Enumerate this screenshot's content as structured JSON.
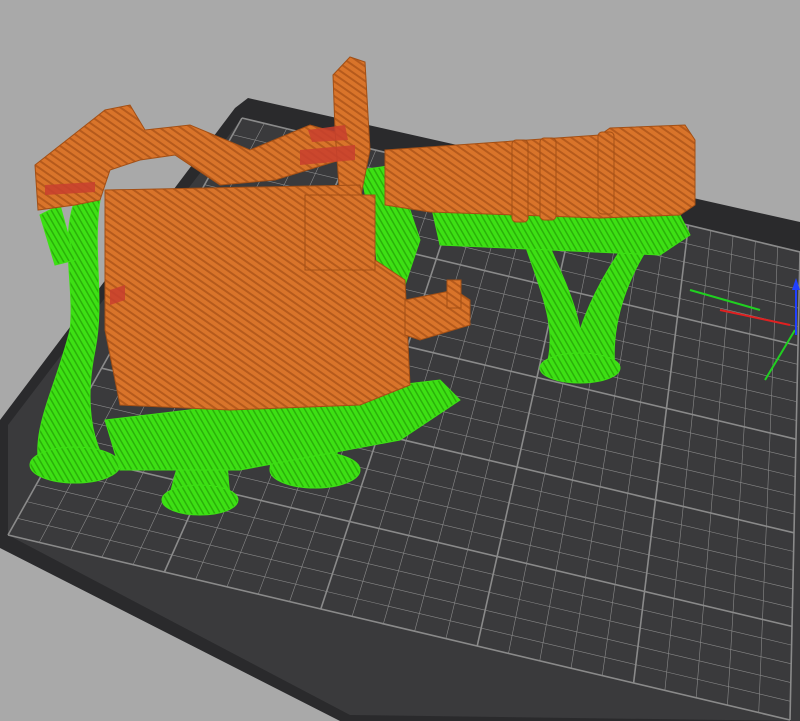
{
  "viewport": {
    "background_color": "#a9a9a9"
  },
  "print_bed": {
    "surface_color": "#3a3a3c",
    "edge_color": "#2a2a2c",
    "grid_color": "#8a8a8a"
  },
  "model": {
    "body_color": "#d9742a",
    "highlight_color": "#c8402e",
    "support_color": "#3de014"
  },
  "axes": {
    "x_color": "#e02020",
    "y_color": "#20d020",
    "z_color": "#2040ff"
  }
}
